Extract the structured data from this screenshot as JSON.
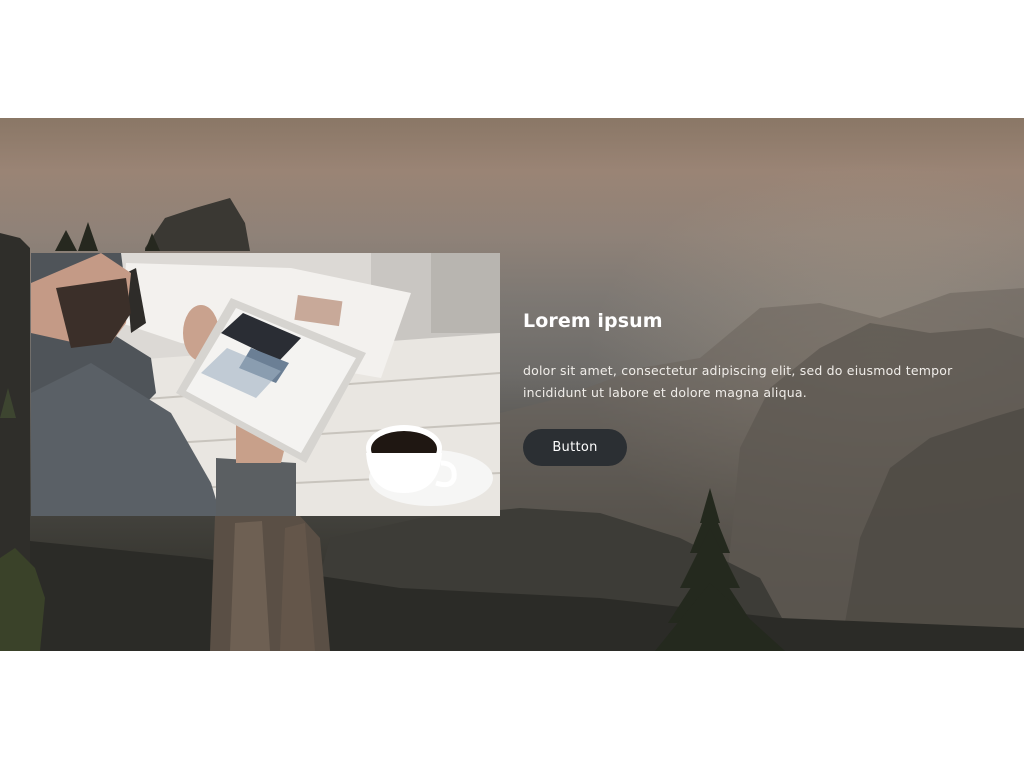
{
  "hero": {
    "image_icon": "mountain-landscape-image",
    "photo_icon": "laptop-coffee-photo"
  },
  "content": {
    "title": "Lorem ipsum",
    "body": "dolor sit amet, consectetur adipiscing elit, sed do eiusmod tempor incididunt ut labore et dolore magna aliqua.",
    "button_label": "Button"
  },
  "colors": {
    "button_bg": "#2b2f33",
    "text": "#ffffff",
    "page_bg": "#ffffff"
  }
}
